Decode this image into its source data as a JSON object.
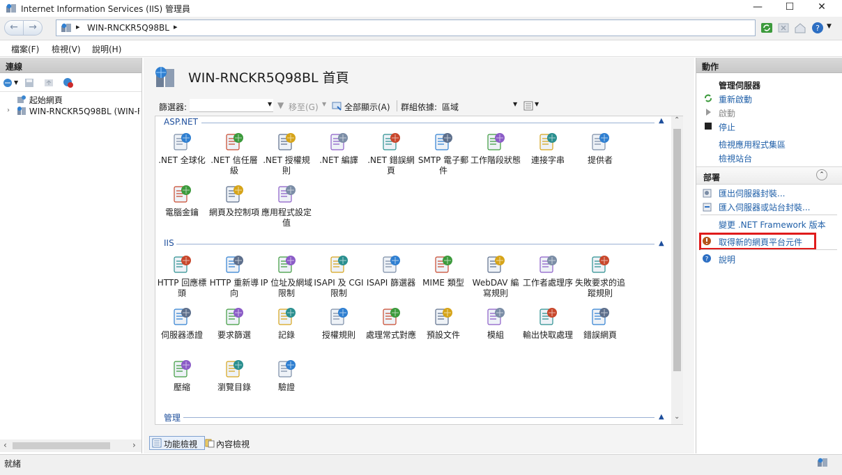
{
  "window": {
    "title": "Internet Information Services (IIS) 管理員",
    "minimize": "—",
    "maximize": "☐",
    "close": "✕"
  },
  "address": {
    "path": "WIN-RNCKR5Q98BL",
    "arrow": "▸"
  },
  "menu": [
    "檔案(F)",
    "檢視(V)",
    "說明(H)"
  ],
  "connections": {
    "header": "連線",
    "tree": [
      {
        "label": "起始網頁"
      },
      {
        "label": "WIN-RNCKR5Q98BL (WIN-F"
      }
    ]
  },
  "center": {
    "page_title": "WIN-RNCKR5Q98BL 首頁",
    "filter_label": "篩選器:",
    "goto_label": "移至(G)",
    "showall_label": "全部顯示(A)",
    "groupby_label": "群組依據:",
    "groupby_value": "區域",
    "groups": [
      {
        "name": "ASP.NET",
        "features": [
          {
            "label": ".NET 全球化",
            "icon": "globe-icon"
          },
          {
            "label": ".NET 信任層級",
            "icon": "trust-icon"
          },
          {
            "label": ".NET 授權規則",
            "icon": "lock-doc-icon"
          },
          {
            "label": ".NET 編譯",
            "icon": "compile-icon"
          },
          {
            "label": ".NET 錯誤網頁",
            "icon": "error-page-icon"
          },
          {
            "label": "SMTP 電子郵件",
            "icon": "smtp-icon"
          },
          {
            "label": "工作階段狀態",
            "icon": "session-icon"
          },
          {
            "label": "連接字串",
            "icon": "db-icon"
          },
          {
            "label": "提供者",
            "icon": "provider-icon"
          },
          {
            "label": "電腦金鑰",
            "icon": "machine-key-icon"
          },
          {
            "label": "網頁及控制項",
            "icon": "pages-controls-icon"
          },
          {
            "label": "應用程式設定值",
            "icon": "app-settings-icon"
          }
        ]
      },
      {
        "name": "IIS",
        "features": [
          {
            "label": "HTTP 回應標頭",
            "icon": "http-headers-icon"
          },
          {
            "label": "HTTP 重新導向",
            "icon": "redirect-icon"
          },
          {
            "label": "IP 位址及網域限制",
            "icon": "ip-icon"
          },
          {
            "label": "ISAPI 及 CGI 限制",
            "icon": "cgi-icon"
          },
          {
            "label": "ISAPI 篩選器",
            "icon": "isapi-icon"
          },
          {
            "label": "MIME 類型",
            "icon": "mime-icon"
          },
          {
            "label": "WebDAV 編寫規則",
            "icon": "webdav-icon"
          },
          {
            "label": "工作者處理序",
            "icon": "worker-icon"
          },
          {
            "label": "失敗要求的追蹤規則",
            "icon": "failed-trace-icon"
          },
          {
            "label": "伺服器憑證",
            "icon": "cert-icon"
          },
          {
            "label": "要求篩選",
            "icon": "request-filter-icon"
          },
          {
            "label": "記錄",
            "icon": "logging-icon"
          },
          {
            "label": "授權規則",
            "icon": "authz-icon"
          },
          {
            "label": "處理常式對應",
            "icon": "handler-icon"
          },
          {
            "label": "預設文件",
            "icon": "default-doc-icon"
          },
          {
            "label": "模組",
            "icon": "modules-icon"
          },
          {
            "label": "輸出快取處理",
            "icon": "output-cache-icon"
          },
          {
            "label": "錯誤網頁",
            "icon": "error-pages-icon"
          },
          {
            "label": "壓縮",
            "icon": "compression-icon"
          },
          {
            "label": "瀏覽目錄",
            "icon": "dir-browse-icon"
          },
          {
            "label": "驗證",
            "icon": "authentication-icon"
          }
        ]
      },
      {
        "name": "管理",
        "features": []
      }
    ],
    "view_tabs": [
      "功能檢視",
      "內容檢視"
    ]
  },
  "actions": {
    "header": "動作",
    "manage_server": "管理伺服器",
    "restart": "重新啟動",
    "start": "啟動",
    "stop": "停止",
    "view_pools": "檢視應用程式集區",
    "view_sites": "檢視站台",
    "deploy_header": "部署",
    "export_pkg": "匯出伺服器封裝...",
    "import_pkg": "匯入伺服器或站台封裝...",
    "change_net": "變更 .NET Framework 版本",
    "get_components": "取得新的網頁平台元件",
    "help": "說明"
  },
  "status": {
    "text": "就緒"
  },
  "colors": {
    "link": "#1f5fa8",
    "group_header": "#1e4f9c",
    "highlight_box": "#e01b1b"
  }
}
